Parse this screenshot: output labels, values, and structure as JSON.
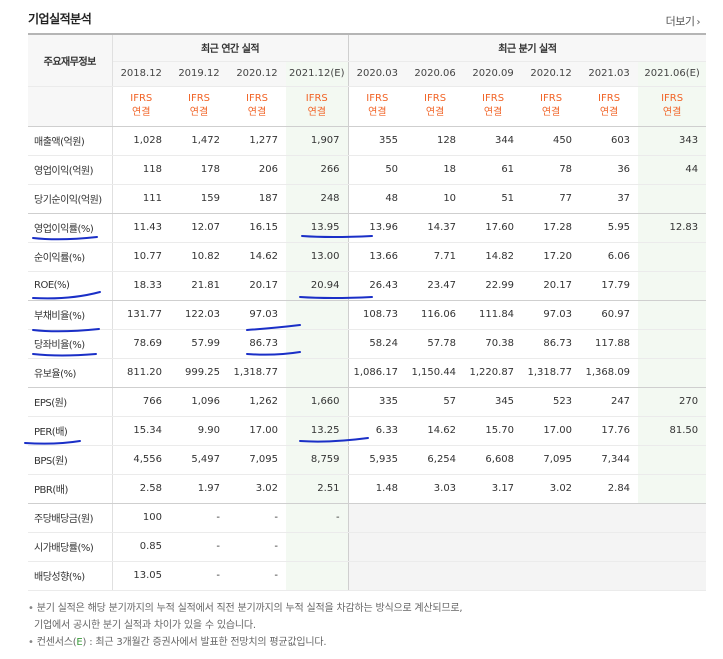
{
  "header": {
    "title": "기업실적분석",
    "more": "더보기",
    "more_icon": "chevron-right-icon"
  },
  "table": {
    "row_head_label": "주요재무정보",
    "group_annual": "최근 연간 실적",
    "group_quarter": "최근 분기 실적",
    "periods": [
      "2018.12",
      "2019.12",
      "2020.12",
      "2021.12(E)",
      "2020.03",
      "2020.06",
      "2020.09",
      "2020.12",
      "2021.03",
      "2021.06(E)"
    ],
    "ifrs_top": "IFRS",
    "ifrs_bottom": "연결",
    "rows": [
      {
        "label": "매출액(억원)",
        "values": [
          "1,028",
          "1,472",
          "1,277",
          "1,907",
          "355",
          "128",
          "344",
          "450",
          "603",
          "343"
        ]
      },
      {
        "label": "영업이익(억원)",
        "values": [
          "118",
          "178",
          "206",
          "266",
          "50",
          "18",
          "61",
          "78",
          "36",
          "44"
        ]
      },
      {
        "label": "당기순이익(억원)",
        "values": [
          "111",
          "159",
          "187",
          "248",
          "48",
          "10",
          "51",
          "77",
          "37",
          ""
        ]
      },
      {
        "label": "영업이익률(%)",
        "values": [
          "11.43",
          "12.07",
          "16.15",
          "13.95",
          "13.96",
          "14.37",
          "17.60",
          "17.28",
          "5.95",
          "12.83"
        ]
      },
      {
        "label": "순이익률(%)",
        "values": [
          "10.77",
          "10.82",
          "14.62",
          "13.00",
          "13.66",
          "7.71",
          "14.82",
          "17.20",
          "6.06",
          ""
        ]
      },
      {
        "label": "ROE(%)",
        "values": [
          "18.33",
          "21.81",
          "20.17",
          "20.94",
          "26.43",
          "23.47",
          "22.99",
          "20.17",
          "17.79",
          ""
        ]
      },
      {
        "label": "부채비율(%)",
        "values": [
          "131.77",
          "122.03",
          "97.03",
          "",
          "108.73",
          "116.06",
          "111.84",
          "97.03",
          "60.97",
          ""
        ]
      },
      {
        "label": "당좌비율(%)",
        "values": [
          "78.69",
          "57.99",
          "86.73",
          "",
          "58.24",
          "57.78",
          "70.38",
          "86.73",
          "117.88",
          ""
        ]
      },
      {
        "label": "유보율(%)",
        "values": [
          "811.20",
          "999.25",
          "1,318.77",
          "",
          "1,086.17",
          "1,150.44",
          "1,220.87",
          "1,318.77",
          "1,368.09",
          ""
        ]
      },
      {
        "label": "EPS(원)",
        "values": [
          "766",
          "1,096",
          "1,262",
          "1,660",
          "335",
          "57",
          "345",
          "523",
          "247",
          "270"
        ]
      },
      {
        "label": "PER(배)",
        "values": [
          "15.34",
          "9.90",
          "17.00",
          "13.25",
          "6.33",
          "14.62",
          "15.70",
          "17.00",
          "17.76",
          "81.50"
        ]
      },
      {
        "label": "BPS(원)",
        "values": [
          "4,556",
          "5,497",
          "7,095",
          "8,759",
          "5,935",
          "6,254",
          "6,608",
          "7,095",
          "7,344",
          ""
        ]
      },
      {
        "label": "PBR(배)",
        "values": [
          "2.58",
          "1.97",
          "3.02",
          "2.51",
          "1.48",
          "3.03",
          "3.17",
          "3.02",
          "2.84",
          ""
        ]
      },
      {
        "label": "주당배당금(원)",
        "values": [
          "100",
          "-",
          "-",
          "-",
          "",
          "",
          "",
          "",
          "",
          ""
        ]
      },
      {
        "label": "시가배당률(%)",
        "values": [
          "0.85",
          "-",
          "-",
          "",
          "",
          "",
          "",
          "",
          "",
          ""
        ]
      },
      {
        "label": "배당성향(%)",
        "values": [
          "13.05",
          "-",
          "-",
          "",
          "",
          "",
          "",
          "",
          "",
          ""
        ]
      }
    ]
  },
  "notes": {
    "line1": "분기 실적은 해당 분기까지의 누적 실적에서 직전 분기까지의 누적 실적을 차감하는 방식으로 계산되므로,",
    "line2": "기업에서 공시한 분기 실적과 차이가 있을 수 있습니다.",
    "line3_prefix": "컨센서스(",
    "line3_e": "E",
    "line3_suffix": ") : 최근 3개월간 증권사에서 발표한 전망치의 평균값입니다."
  },
  "colors": {
    "ifrs": "#f16326",
    "estimate_bg": "#f3f9f2",
    "annotation_ink": "#1a2fc7",
    "consensus_e": "#3a9b3a"
  }
}
